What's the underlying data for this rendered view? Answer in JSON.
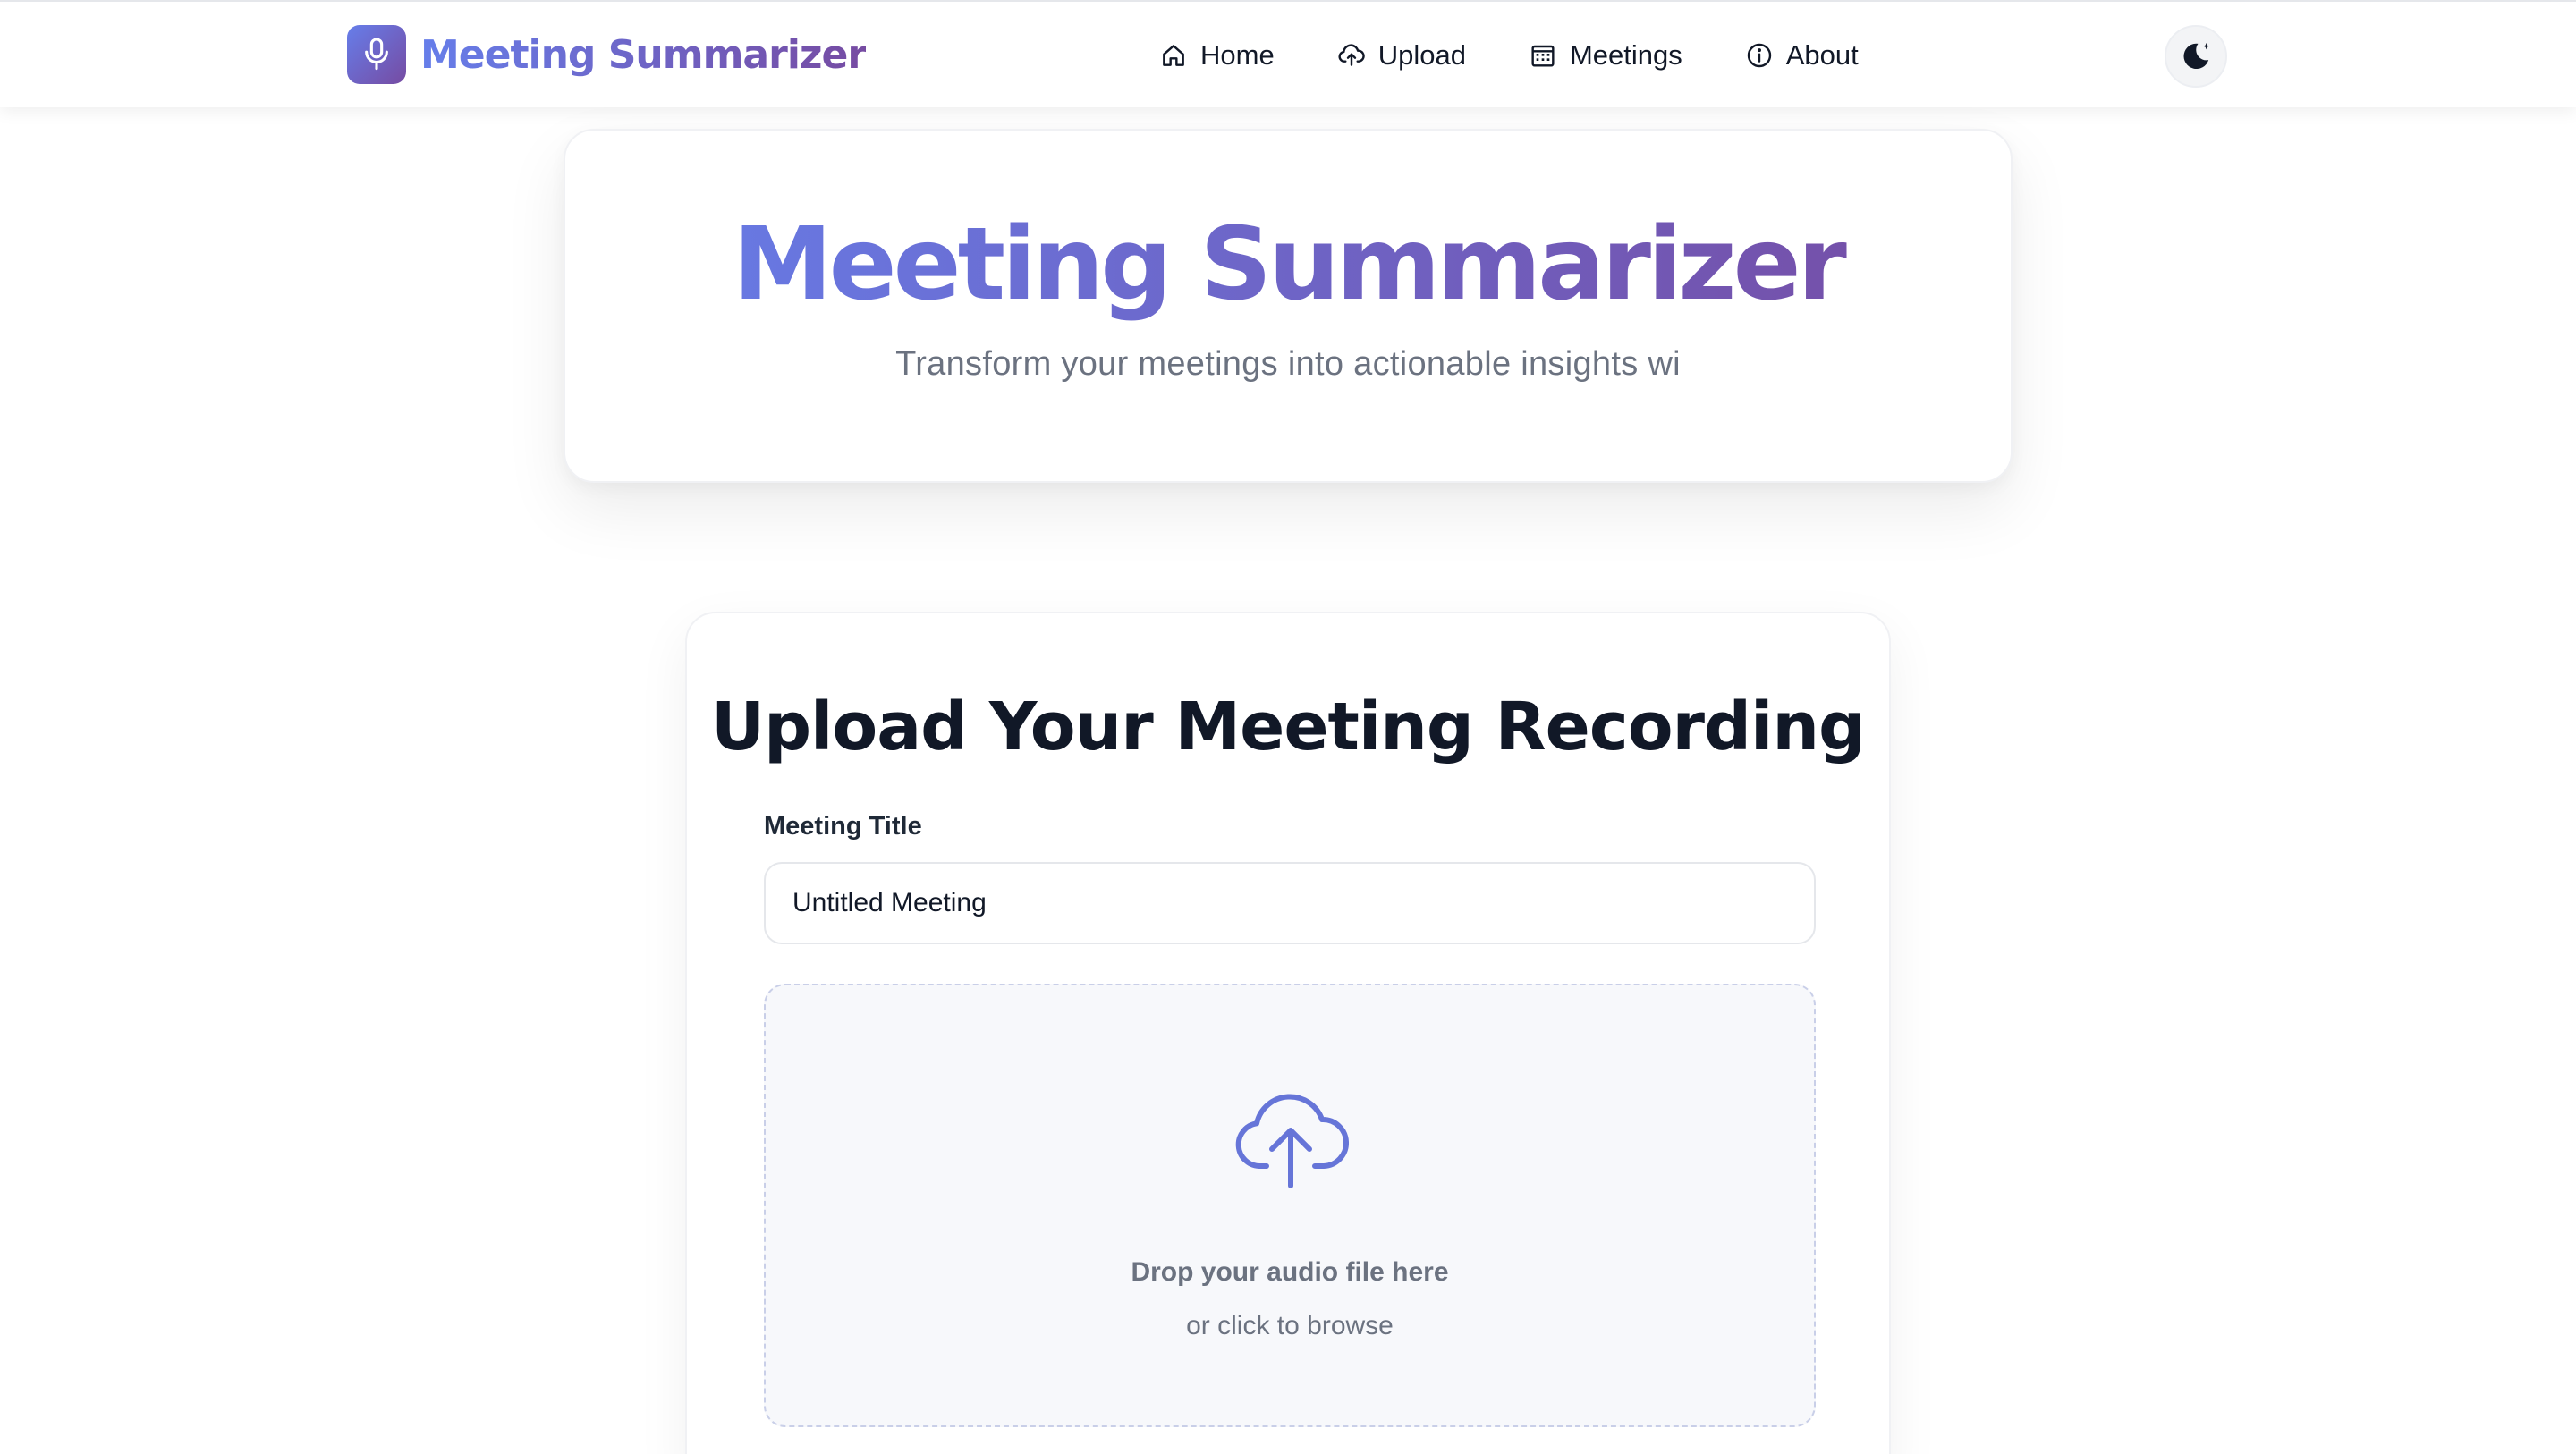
{
  "brand": {
    "name": "Meeting Summarizer",
    "logo_icon": "microphone-icon"
  },
  "nav": {
    "items": [
      {
        "label": "Home",
        "icon": "home-icon"
      },
      {
        "label": "Upload",
        "icon": "cloud-upload-icon"
      },
      {
        "label": "Meetings",
        "icon": "calendar-icon"
      },
      {
        "label": "About",
        "icon": "info-icon"
      }
    ],
    "theme_toggle_icon": "moon-stars-icon"
  },
  "hero": {
    "title": "Meeting Summarizer",
    "subtitle": "Transform your meetings into actionable insights wi"
  },
  "upload": {
    "heading": "Upload Your Meeting Recording",
    "title_label": "Meeting Title",
    "title_value": "Untitled Meeting",
    "drop_primary": "Drop your audio file here",
    "drop_secondary": "or click to browse",
    "upload_icon": "cloud-upload-icon"
  },
  "colors": {
    "gradient_start": "#667eea",
    "gradient_end": "#764ba2",
    "text_primary": "#111827",
    "text_muted": "#6b7280",
    "dropzone_bg": "#f7f8fb"
  }
}
